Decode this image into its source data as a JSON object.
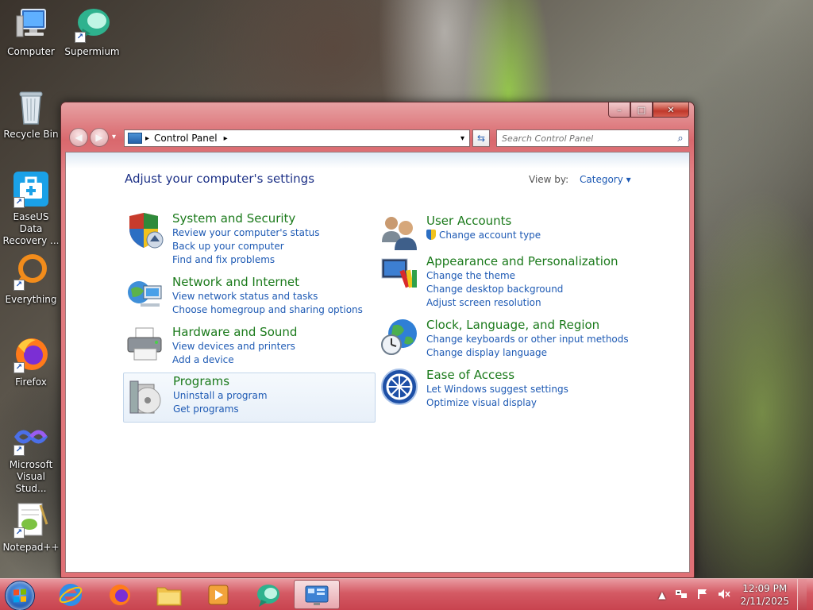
{
  "desktop": {
    "icons": [
      {
        "label": "Computer"
      },
      {
        "label": "Supermium"
      },
      {
        "label": "Recycle Bin"
      },
      {
        "label": "EaseUS Data Recovery ..."
      },
      {
        "label": "Everything"
      },
      {
        "label": "Firefox"
      },
      {
        "label": "Microsoft Visual Stud..."
      },
      {
        "label": "Notepad++"
      }
    ]
  },
  "window": {
    "controls": {
      "minimize": "–",
      "maximize": "□",
      "close": "✕"
    },
    "nav": {
      "back": "◀",
      "forward": "▶",
      "dropdown": "▾"
    },
    "address": {
      "segment": "Control Panel",
      "separator": "▸"
    },
    "refresh": "⇆",
    "search": {
      "placeholder": "Search Control Panel",
      "icon": "⌕"
    },
    "page_title": "Adjust your computer's settings",
    "view_by": {
      "label": "View by:",
      "value": "Category",
      "arrow": "▾"
    },
    "categories_left": [
      {
        "title": "System and Security",
        "icon": "shield-icon",
        "links": [
          "Review your computer's status",
          "Back up your computer",
          "Find and fix problems"
        ]
      },
      {
        "title": "Network and Internet",
        "icon": "network-icon",
        "links": [
          "View network status and tasks",
          "Choose homegroup and sharing options"
        ]
      },
      {
        "title": "Hardware and Sound",
        "icon": "printer-icon",
        "links": [
          "View devices and printers",
          "Add a device"
        ]
      },
      {
        "title": "Programs",
        "icon": "programs-icon",
        "links": [
          "Uninstall a program",
          "Get programs"
        ]
      }
    ],
    "categories_right": [
      {
        "title": "User Accounts",
        "icon": "users-icon",
        "links": [
          "Change account type"
        ]
      },
      {
        "title": "Appearance and Personalization",
        "icon": "appearance-icon",
        "links": [
          "Change the theme",
          "Change desktop background",
          "Adjust screen resolution"
        ]
      },
      {
        "title": "Clock, Language, and Region",
        "icon": "globe-clock-icon",
        "links": [
          "Change keyboards or other input methods",
          "Change display language"
        ]
      },
      {
        "title": "Ease of Access",
        "icon": "ease-of-access-icon",
        "links": [
          "Let Windows suggest settings",
          "Optimize visual display"
        ]
      }
    ]
  },
  "taskbar": {
    "apps": [
      "Internet Explorer",
      "Firefox",
      "File Explorer",
      "Media Player",
      "Supermium",
      "Control Panel"
    ],
    "clock": {
      "time": "12:09 PM",
      "date": "2/11/2025"
    },
    "tray": {
      "chevron": "▲"
    }
  }
}
